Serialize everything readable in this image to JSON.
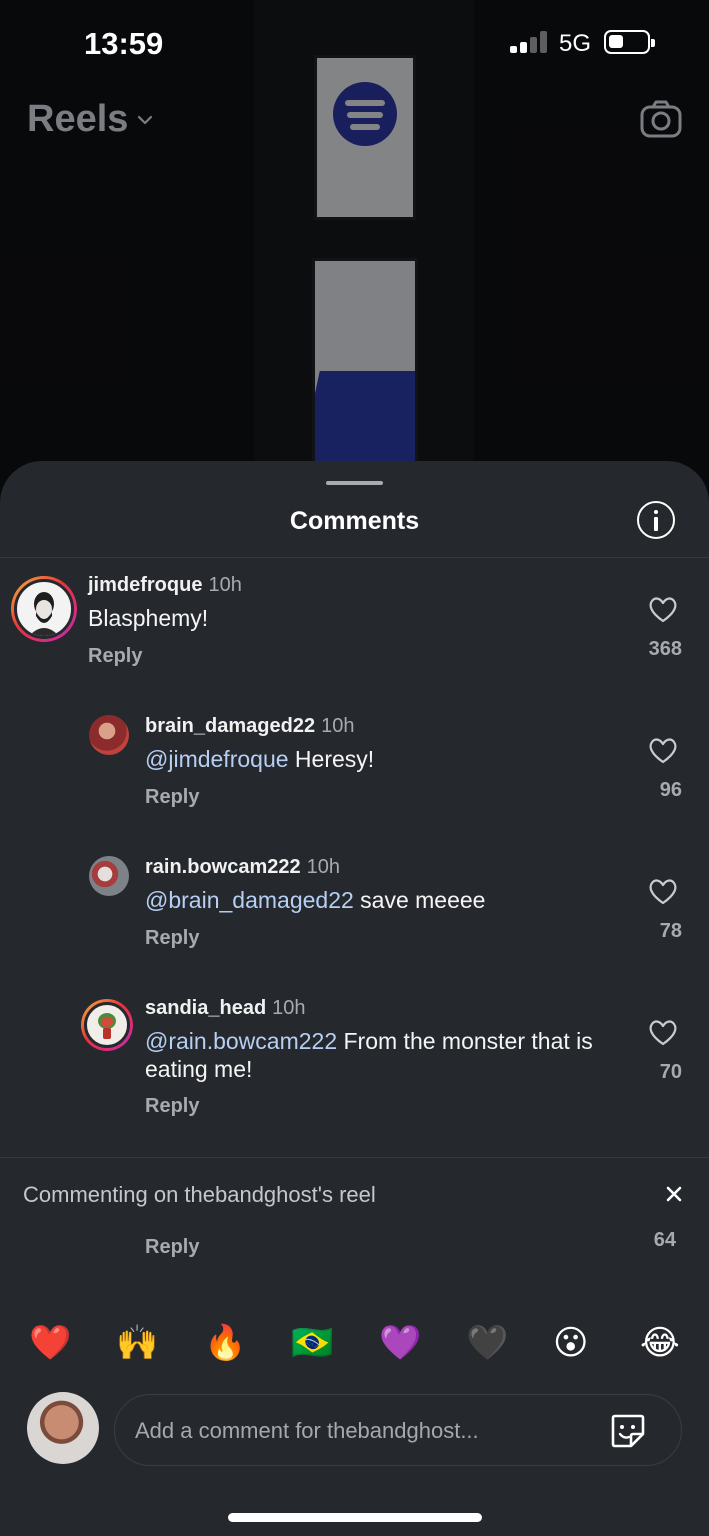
{
  "status": {
    "time": "13:59",
    "network": "5G",
    "signal_bars": 2,
    "battery_level": 0.35
  },
  "header": {
    "title": "Reels"
  },
  "sheet": {
    "title": "Comments",
    "comments": [
      {
        "username": "jimdefroque",
        "age": "10h",
        "mention": "",
        "text": "Blasphemy!",
        "reply": "Reply",
        "likes": "368"
      },
      {
        "username": "brain_damaged22",
        "age": "10h",
        "mention": "@jimdefroque",
        "text": " Heresy!",
        "reply": "Reply",
        "likes": "96"
      },
      {
        "username": "rain.bowcam222",
        "age": "10h",
        "mention": "@brain_damaged22",
        "text": " save meeee",
        "reply": "Reply",
        "likes": "78"
      },
      {
        "username": "sandia_head",
        "age": "10h",
        "mention": "@rain.bowcam222",
        "text": " From the monster that is eating me!",
        "reply": "Reply",
        "likes": "70"
      }
    ],
    "commenting_on": "Commenting on thebandghost's reel",
    "hidden_reply": {
      "reply": "Reply",
      "likes": "64"
    },
    "emojis": [
      "❤️",
      "🙌",
      "🔥",
      "🇧🇷",
      "💜",
      "🖤",
      "😮",
      "😂"
    ],
    "input_placeholder": "Add a comment for thebandghost..."
  },
  "colors": {
    "sheet_bg": "#25282c",
    "mention": "#b7cff3",
    "muted": "#a8aaae"
  }
}
